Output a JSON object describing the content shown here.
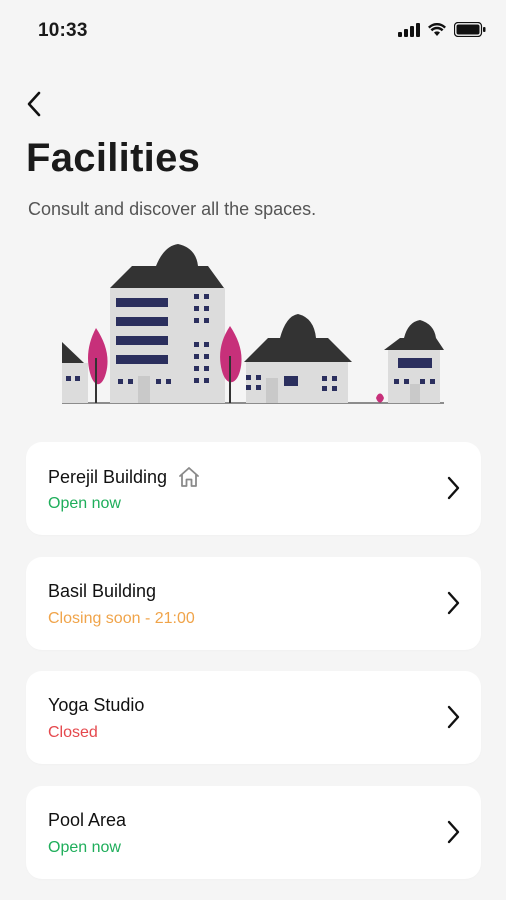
{
  "status_bar": {
    "time": "10:33"
  },
  "header": {
    "title": "Facilities",
    "subtitle": "Consult and discover all the spaces."
  },
  "facilities": [
    {
      "name": "Perejil Building",
      "status": "Open now",
      "status_type": "open",
      "icon": "home-icon"
    },
    {
      "name": "Basil Building",
      "status": "Closing soon - 21:00",
      "status_type": "soon"
    },
    {
      "name": "Yoga Studio",
      "status": "Closed",
      "status_type": "closed"
    },
    {
      "name": "Pool Area",
      "status": "Open now",
      "status_type": "open"
    }
  ],
  "colors": {
    "open": "#1fae5b",
    "soon": "#f0a44a",
    "closed": "#e5484d",
    "accent_magenta": "#c7307a",
    "roof_dark": "#333333",
    "window_navy": "#2b2f5e"
  }
}
